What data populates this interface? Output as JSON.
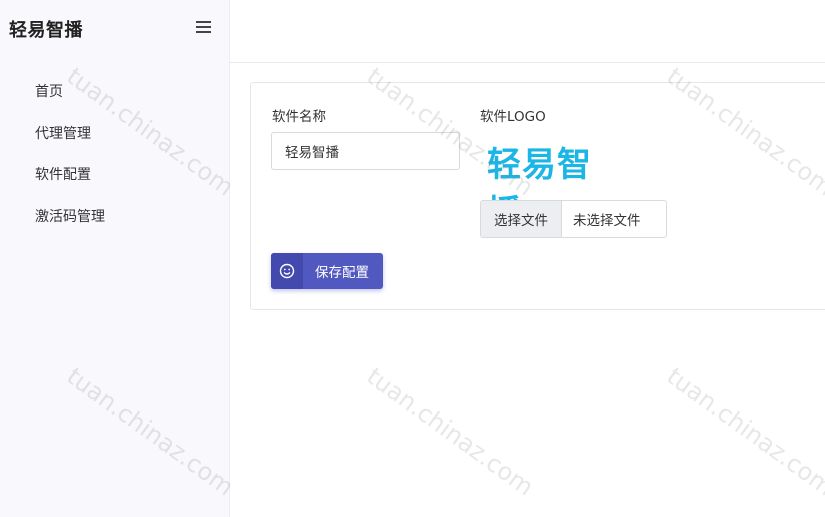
{
  "sidebar": {
    "brand": "轻易智播",
    "menu_icon": "hamburger-menu-icon",
    "items": [
      {
        "label": "首页"
      },
      {
        "label": "代理管理"
      },
      {
        "label": "软件配置"
      },
      {
        "label": "激活码管理"
      }
    ]
  },
  "form": {
    "name_label": "软件名称",
    "name_value": "轻易智播",
    "logo_label": "软件LOGO",
    "logo_text": "轻易智播",
    "file_button": "选择文件",
    "file_status": "未选择文件",
    "save_label": "保存配置",
    "save_icon": "smiley-icon"
  },
  "watermark": "tuan.chinaz.com",
  "colors": {
    "accent": "#5159c1",
    "logo": "#1cb6e6",
    "sidebar_bg": "#f8f8fd"
  }
}
